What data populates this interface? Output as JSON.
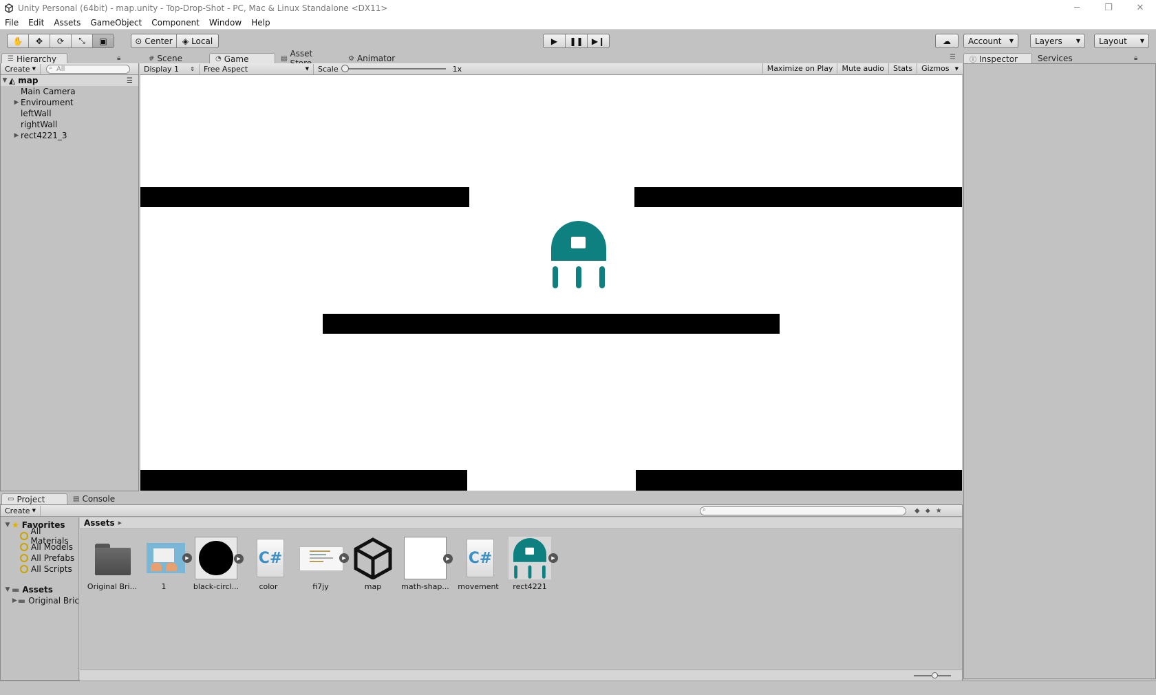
{
  "window": {
    "title": "Unity Personal (64bit) - map.unity - Top-Drop-Shot - PC, Mac & Linux Standalone <DX11>",
    "controls": [
      "─",
      "❐",
      "✕"
    ]
  },
  "menu": [
    "File",
    "Edit",
    "Assets",
    "GameObject",
    "Component",
    "Window",
    "Help"
  ],
  "toolbar": {
    "tools": [
      "hand-icon",
      "move-icon",
      "rotate-icon",
      "scale-icon",
      "rect-tool-icon"
    ],
    "pivot": "Center",
    "space": "Local",
    "account": "Account",
    "layers": "Layers",
    "layout": "Layout"
  },
  "hierarchy": {
    "tab": "Hierarchy",
    "create": "Create",
    "search_placeholder": "All",
    "scene": "map",
    "items": [
      "Main Camera",
      "Enviroument",
      "leftWall",
      "rightWall",
      "rect4221_3"
    ]
  },
  "center_tabs": [
    "Scene",
    "Game",
    "Asset Store",
    "Animator"
  ],
  "game_bar": {
    "display": "Display 1",
    "aspect": "Free Aspect",
    "scale_label": "Scale",
    "scale_value": "1x",
    "maximize": "Maximize on Play",
    "mute": "Mute audio",
    "stats": "Stats",
    "gizmos": "Gizmos"
  },
  "inspector_tabs": [
    "Inspector",
    "Services"
  ],
  "project": {
    "tabs": [
      "Project",
      "Console"
    ],
    "create": "Create",
    "favorites_label": "Favorites",
    "favorites": [
      "All Materials",
      "All Models",
      "All Prefabs",
      "All Scripts"
    ],
    "assets_label": "Assets",
    "asset_folder": "Original Bric",
    "breadcrumb": "Assets",
    "assets": [
      "Original Bri...",
      "1",
      "black-circl...",
      "color",
      "fi7jy",
      "map",
      "math-shap...",
      "movement",
      "rect4221"
    ]
  },
  "colors": {
    "teal": "#0e8080",
    "editor_bg": "#c2c2c2"
  }
}
